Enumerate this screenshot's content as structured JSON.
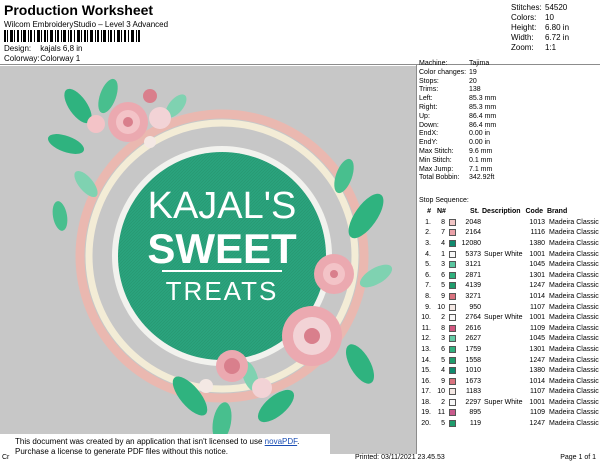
{
  "header": {
    "title": "Production Worksheet",
    "subtitle": "Wilcom EmbroideryStudio – Level 3 Advanced",
    "design_label": "Design:",
    "design_value": "kajals 6,8 in",
    "colorway_label": "Colorway:",
    "colorway_value": "Colorway 1"
  },
  "stats": [
    {
      "label": "Stitches:",
      "value": "54520"
    },
    {
      "label": "Colors:",
      "value": "10"
    },
    {
      "label": "Height:",
      "value": "6.80 in"
    },
    {
      "label": "Width:",
      "value": "6.72 in"
    },
    {
      "label": "Zoom:",
      "value": "1:1"
    }
  ],
  "design": {
    "line1": "KAJAL'S",
    "line2": "SWEET",
    "line3": "TREATS",
    "colors": {
      "background": "#c7c7c7",
      "disc": "#2aa37d",
      "disc_ring": "#f2f2ee",
      "frame_outer": "#eab8b0",
      "frame_inner": "#f3ecd6",
      "leaf": "#2fb37f",
      "leaf_light": "#7fd2b1",
      "rose": "#eba9b0",
      "rose_dark": "#d97f8c"
    }
  },
  "params": [
    {
      "label": "Machine:",
      "value": "Tajima"
    },
    {
      "label": "Color changes:",
      "value": "19"
    },
    {
      "label": "Stops:",
      "value": "20"
    },
    {
      "label": "Trims:",
      "value": "138"
    },
    {
      "label": "Left:",
      "value": "85.3 mm"
    },
    {
      "label": "Right:",
      "value": "85.3 mm"
    },
    {
      "label": "Up:",
      "value": "86.4 mm"
    },
    {
      "label": "Down:",
      "value": "86.4 mm"
    },
    {
      "label": "EndX:",
      "value": "0.00 in"
    },
    {
      "label": "EndY:",
      "value": "0.00 in"
    },
    {
      "label": "Max Stitch:",
      "value": "9.6 mm"
    },
    {
      "label": "Min Stitch:",
      "value": "0.1 mm"
    },
    {
      "label": "Max Jump:",
      "value": "7.1 mm"
    },
    {
      "label": "Total Bobbin:",
      "value": "342.92ft"
    }
  ],
  "stop_sequence_title": "Stop Sequence:",
  "stop_columns": {
    "hash": "#",
    "n": "N#",
    "st": "St.",
    "desc": "Description",
    "code": "Code",
    "brand": "Brand"
  },
  "stops": [
    {
      "i": "1.",
      "n": "8",
      "color": "#f2c6c6",
      "st": "2048",
      "desc": "",
      "code": "1013",
      "brand": "Madeira Classic 40"
    },
    {
      "i": "2.",
      "n": "7",
      "color": "#eaa1a8",
      "st": "2164",
      "desc": "",
      "code": "1116",
      "brand": "Madeira Classic 40"
    },
    {
      "i": "3.",
      "n": "4",
      "color": "#108a6e",
      "st": "12080",
      "desc": "",
      "code": "1380",
      "brand": "Madeira Classic 40"
    },
    {
      "i": "4.",
      "n": "1",
      "color": "#f6f6f6",
      "st": "5373",
      "desc": "Super White",
      "code": "1001",
      "brand": "Madeira Classic 40"
    },
    {
      "i": "5.",
      "n": "3",
      "color": "#59c6a0",
      "st": "3121",
      "desc": "",
      "code": "1045",
      "brand": "Madeira Classic 40"
    },
    {
      "i": "6.",
      "n": "6",
      "color": "#2fb07d",
      "st": "2871",
      "desc": "",
      "code": "1301",
      "brand": "Madeira Classic 40"
    },
    {
      "i": "7.",
      "n": "5",
      "color": "#1f9c6c",
      "st": "4139",
      "desc": "",
      "code": "1247",
      "brand": "Madeira Classic 40"
    },
    {
      "i": "8.",
      "n": "9",
      "color": "#d9727e",
      "st": "3271",
      "desc": "",
      "code": "1014",
      "brand": "Madeira Classic 40"
    },
    {
      "i": "9.",
      "n": "10",
      "color": "#f4e8e4",
      "st": "950",
      "desc": "",
      "code": "1107",
      "brand": "Madeira Classic 40"
    },
    {
      "i": "10.",
      "n": "2",
      "color": "#f6f6f6",
      "st": "2764",
      "desc": "Super White",
      "code": "1001",
      "brand": "Madeira Classic 40"
    },
    {
      "i": "11.",
      "n": "8",
      "color": "#d2567f",
      "st": "2616",
      "desc": "",
      "code": "1109",
      "brand": "Madeira Classic 40"
    },
    {
      "i": "12.",
      "n": "3",
      "color": "#64cba6",
      "st": "2627",
      "desc": "",
      "code": "1045",
      "brand": "Madeira Classic 40"
    },
    {
      "i": "13.",
      "n": "6",
      "color": "#2fb07d",
      "st": "1759",
      "desc": "",
      "code": "1301",
      "brand": "Madeira Classic 40"
    },
    {
      "i": "14.",
      "n": "5",
      "color": "#1f9c6c",
      "st": "1558",
      "desc": "",
      "code": "1247",
      "brand": "Madeira Classic 40"
    },
    {
      "i": "15.",
      "n": "4",
      "color": "#108a6e",
      "st": "1010",
      "desc": "",
      "code": "1380",
      "brand": "Madeira Classic 40"
    },
    {
      "i": "16.",
      "n": "9",
      "color": "#d9727e",
      "st": "1673",
      "desc": "",
      "code": "1014",
      "brand": "Madeira Classic 40"
    },
    {
      "i": "17.",
      "n": "10",
      "color": "#f4e8e4",
      "st": "1183",
      "desc": "",
      "code": "1107",
      "brand": "Madeira Classic 40"
    },
    {
      "i": "18.",
      "n": "2",
      "color": "#f6f6f6",
      "st": "2297",
      "desc": "Super White",
      "code": "1001",
      "brand": "Madeira Classic 40"
    },
    {
      "i": "19.",
      "n": "11",
      "color": "#c85a8c",
      "st": "895",
      "desc": "",
      "code": "1109",
      "brand": "Madeira Classic 40"
    },
    {
      "i": "20.",
      "n": "5",
      "color": "#1f9c6c",
      "st": "119",
      "desc": "",
      "code": "1247",
      "brand": "Madeira Classic 40"
    }
  ],
  "notice": {
    "line1_prefix": "This document was created by an application that isn't licensed to use ",
    "link": "novaPDF",
    "line1_suffix": ".",
    "line2": "Purchase a license to generate PDF files without this notice."
  },
  "footer": {
    "cr": "Cr",
    "printed": "Printed: 03/11/2021 23.45.53",
    "page": "Page 1 of 1"
  }
}
